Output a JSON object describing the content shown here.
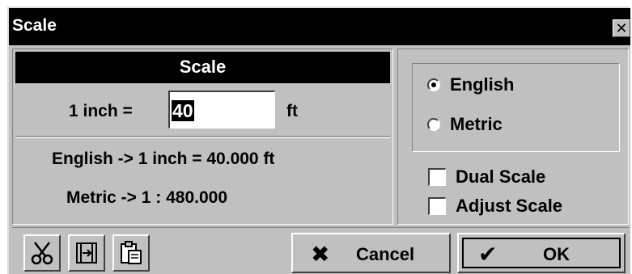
{
  "window": {
    "title": "Scale",
    "close_glyph": "✕"
  },
  "scale": {
    "header": "Scale",
    "inch_label": "1 inch =",
    "inch_value": "40",
    "unit": "ft",
    "english_info": "English -> 1 inch = 40.000 ft",
    "metric_info": "Metric -> 1 : 480.000"
  },
  "units": {
    "options": [
      {
        "label": "English",
        "selected": true
      },
      {
        "label": "Metric",
        "selected": false
      }
    ]
  },
  "options": {
    "dual_scale": {
      "label": "Dual Scale",
      "checked": false
    },
    "adjust_scale": {
      "label": "Adjust Scale",
      "checked": false
    }
  },
  "toolbar": {
    "icons": [
      "scissors-icon",
      "fit-width-icon",
      "paste-icon"
    ]
  },
  "buttons": {
    "cancel_label": "Cancel",
    "cancel_glyph": "✖",
    "ok_label": "OK",
    "ok_glyph": "✔"
  }
}
